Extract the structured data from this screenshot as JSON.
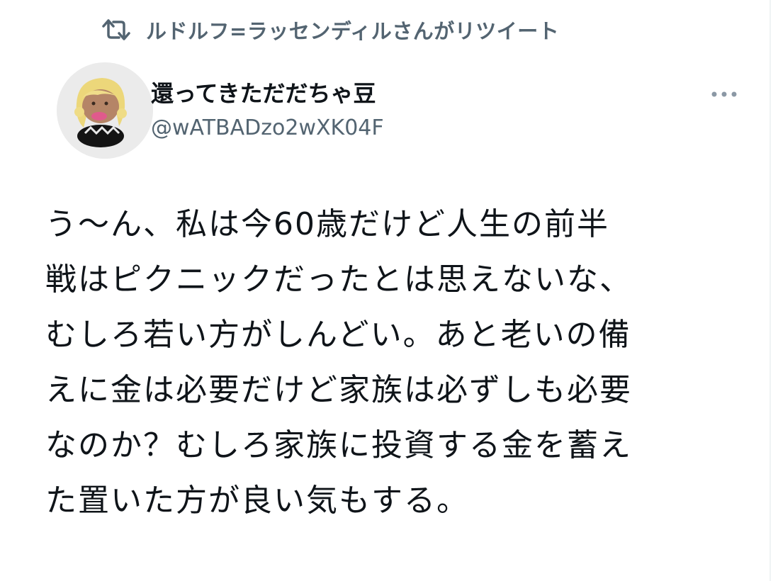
{
  "retweet_header": {
    "icon": "retweet-icon",
    "text": "ルドルフ=ラッセンディルさんがリツイート"
  },
  "author": {
    "avatar": "avatar-image",
    "display_name": "還ってきただだちゃ豆",
    "handle": "@wATBADzo2wXK04F"
  },
  "more_menu": {
    "icon": "more-horizontal-icon"
  },
  "tweet": {
    "text": "う～ん、私は今60歳だけど人生の前半\n戦はピクニックだったとは思えないな、\nむしろ若い方がしんどい。あと老いの備\nえに金は必要だけど家族は必ずしも必要\nなのか？むしろ家族に投資する金を蓄え\nた置いた方が良い気もする。"
  },
  "colors": {
    "text_primary": "#0f1419",
    "text_secondary": "#536471",
    "background": "#ffffff"
  }
}
